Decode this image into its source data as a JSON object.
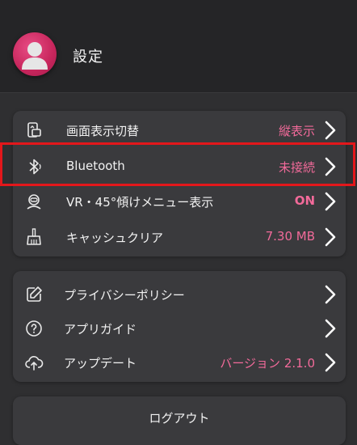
{
  "header": {
    "title": "設定",
    "avatar_icon": "user-avatar-icon"
  },
  "section1": {
    "items": [
      {
        "icon": "phone-rotate-icon",
        "label": "画面表示切替",
        "value": "縦表示"
      },
      {
        "icon": "bluetooth-icon",
        "label": "Bluetooth",
        "value": "未接続"
      },
      {
        "icon": "vr-headset-icon",
        "label": "VR・45°傾けメニュー表示",
        "value": "ON"
      },
      {
        "icon": "broom-icon",
        "label": "キャッシュクリア",
        "value": "7.30 MB"
      }
    ]
  },
  "section2": {
    "items": [
      {
        "icon": "edit-document-icon",
        "label": "プライバシーポリシー",
        "value": ""
      },
      {
        "icon": "help-circle-icon",
        "label": "アプリガイド",
        "value": ""
      },
      {
        "icon": "cloud-upload-icon",
        "label": "アップデート",
        "value": "バージョン 2.1.0"
      }
    ]
  },
  "logout": {
    "label": "ログアウト"
  },
  "colors": {
    "accent": "#f26a9a",
    "highlight": "#e3171b",
    "background": "#2f2f31",
    "card": "#3a3a3d"
  }
}
